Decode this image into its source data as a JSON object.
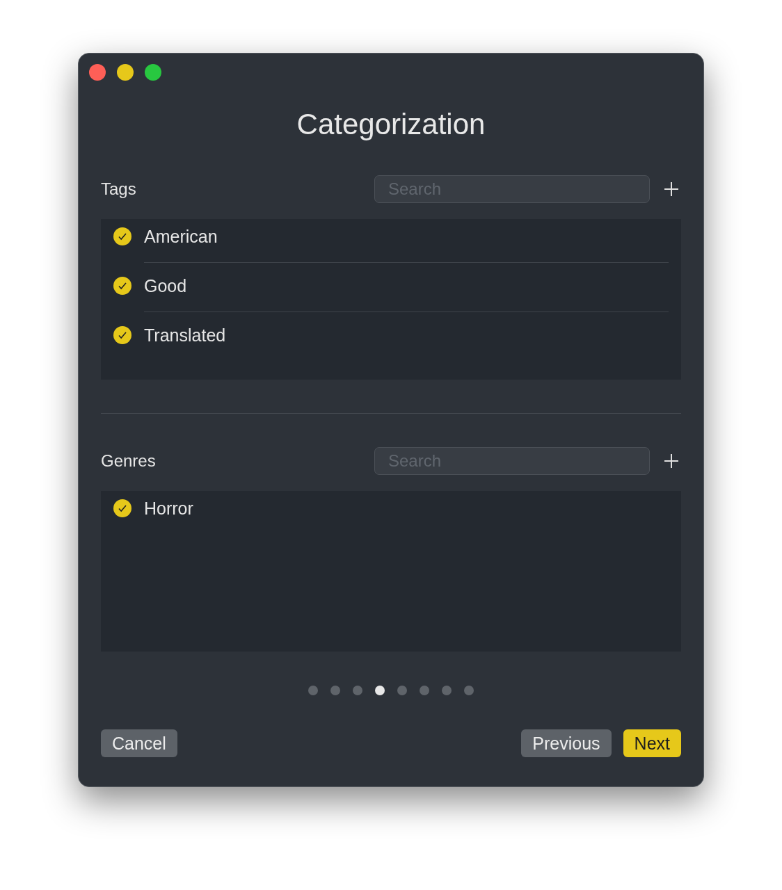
{
  "window": {
    "title": "Categorization"
  },
  "sections": [
    {
      "title": "Tags",
      "search": {
        "placeholder": "Search"
      },
      "items": [
        {
          "label": "American",
          "checked": true
        },
        {
          "label": "Good",
          "checked": true
        },
        {
          "label": "Translated",
          "checked": true
        }
      ]
    },
    {
      "title": "Genres",
      "search": {
        "placeholder": "Search"
      },
      "items": [
        {
          "label": "Horror",
          "checked": true
        }
      ]
    }
  ],
  "pager": [
    {
      "selected": false
    },
    {
      "selected": false
    },
    {
      "selected": false
    },
    {
      "selected": true
    },
    {
      "selected": false
    },
    {
      "selected": false
    },
    {
      "selected": false
    },
    {
      "selected": false
    }
  ],
  "buttons": [
    {
      "label": "Cancel",
      "kind": "secondary"
    },
    {
      "label": "Previous",
      "kind": "secondary"
    },
    {
      "label": "Next",
      "kind": "primary"
    }
  ]
}
